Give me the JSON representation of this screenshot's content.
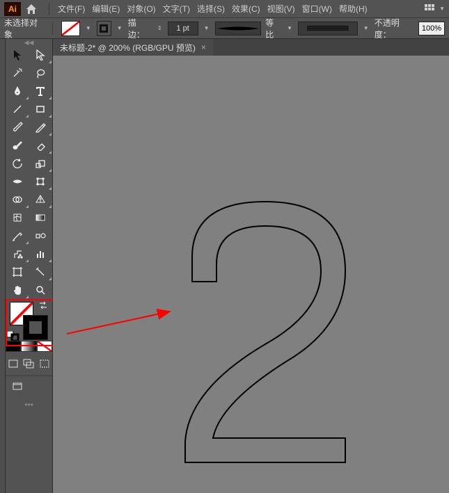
{
  "app": {
    "logo_text": "Ai"
  },
  "menu": {
    "file": "文件(F)",
    "edit": "编辑(E)",
    "object": "对象(O)",
    "type": "文字(T)",
    "select": "选择(S)",
    "effect": "效果(C)",
    "view": "视图(V)",
    "window": "窗口(W)",
    "help": "帮助(H)"
  },
  "options": {
    "no_selection": "未选择对象",
    "stroke_label": "描边：",
    "stroke_value": "1 pt",
    "scale_label": "等比",
    "opacity_label": "不透明度：",
    "opacity_value": "100%"
  },
  "document": {
    "tab_title": "未标题-2* @ 200% (RGB/GPU 预览)"
  },
  "tools": {
    "selection": "selection-tool",
    "direct": "direct-selection-tool",
    "wand": "magic-wand-tool",
    "lasso": "lasso-tool",
    "pen": "pen-tool",
    "type": "type-tool",
    "line": "line-segment-tool",
    "rect": "rectangle-tool",
    "brush": "paintbrush-tool",
    "pencil": "pencil-tool",
    "blob": "blob-brush-tool",
    "eraser": "eraser-tool",
    "rotate": "rotate-tool",
    "scale": "scale-tool",
    "width": "width-tool",
    "free": "free-transform-tool",
    "shapebuilder": "shape-builder-tool",
    "perspective": "perspective-grid-tool",
    "mesh": "mesh-tool",
    "gradient": "gradient-tool",
    "eyedrop": "eyedropper-tool",
    "blend": "blend-tool",
    "symbol": "symbol-sprayer-tool",
    "graph": "column-graph-tool",
    "artboard": "artboard-tool",
    "slice": "slice-tool",
    "hand": "hand-tool",
    "zoom": "zoom-tool"
  },
  "colors": {
    "accent_red": "#ff0000",
    "canvas_bg": "#808080"
  }
}
